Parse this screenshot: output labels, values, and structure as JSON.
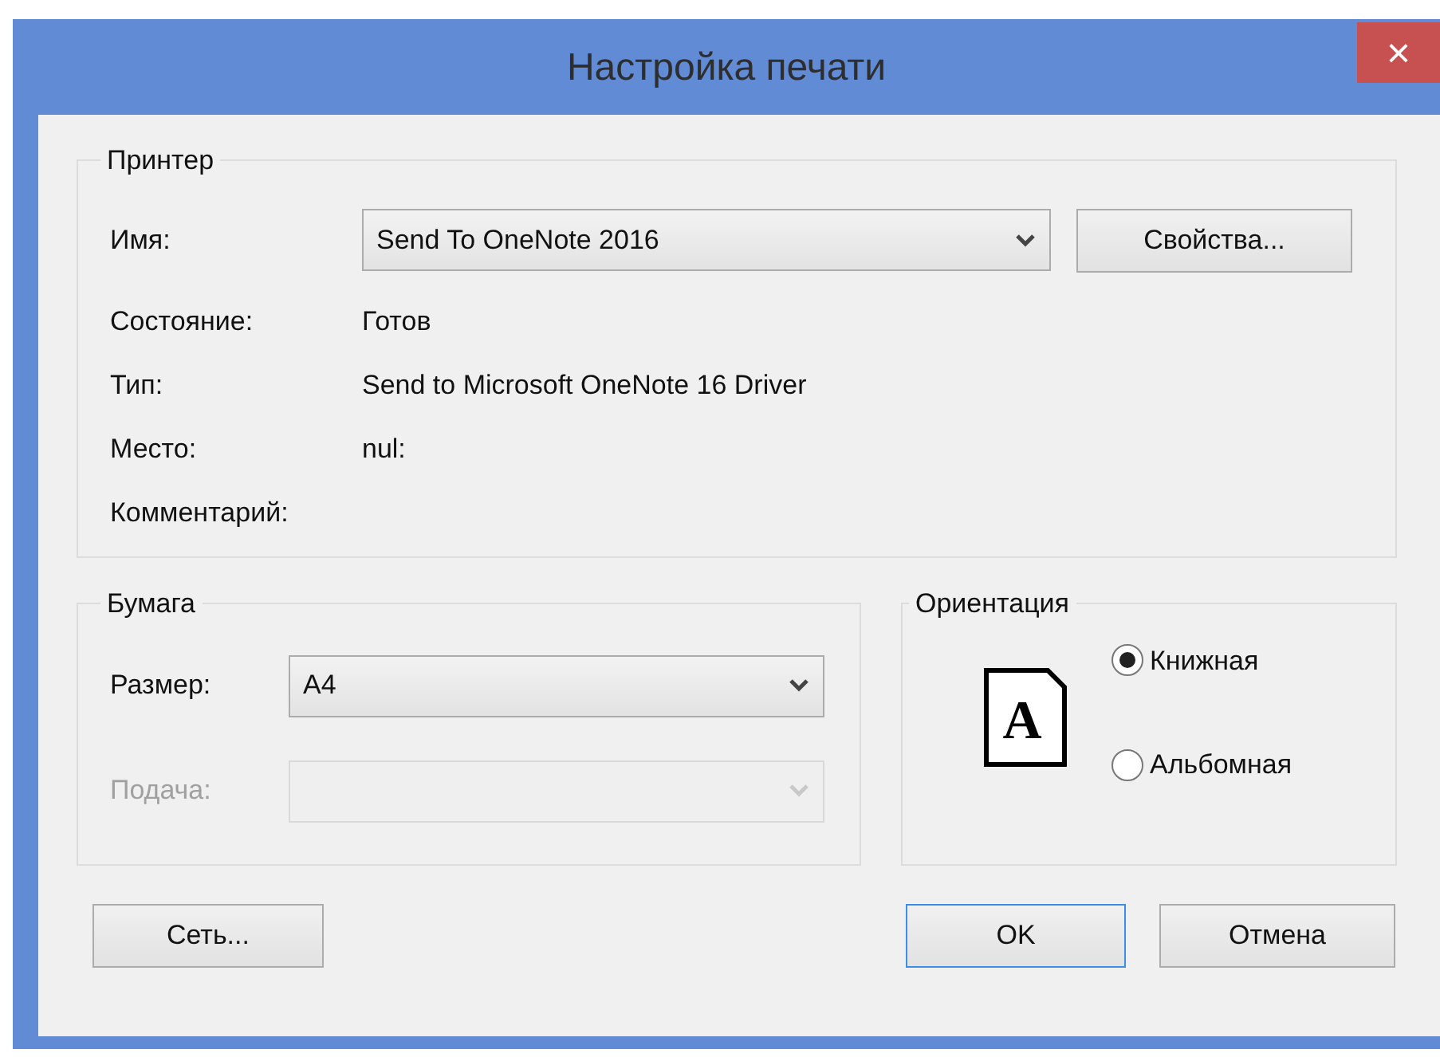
{
  "window": {
    "title": "Настройка печати",
    "close": "×"
  },
  "printer": {
    "legend": "Принтер",
    "name_label": "Имя:",
    "name_value": "Send To OneNote 2016",
    "properties_button": "Свойства...",
    "info": [
      {
        "label": "Состояние:",
        "value": "Готов"
      },
      {
        "label": "Тип:",
        "value": "Send to Microsoft OneNote 16 Driver"
      },
      {
        "label": "Место:",
        "value": "nul:"
      },
      {
        "label": "Комментарий:"
      }
    ]
  },
  "paper": {
    "legend": "Бумага",
    "fields": [
      {
        "label": "Размер:",
        "value": "A4",
        "disabled": false
      },
      {
        "label": "Подача:",
        "disabled": true
      }
    ]
  },
  "orientation": {
    "legend": "Ориентация",
    "preview_letter": "A",
    "options": [
      {
        "label": "Книжная",
        "selected": true
      },
      {
        "label": "Альбомная",
        "selected": false
      }
    ]
  },
  "buttons": [
    {
      "label": "Сеть...",
      "default": false
    },
    {
      "label": "OK",
      "default": true
    },
    {
      "label": "Отмена",
      "default": false
    }
  ]
}
